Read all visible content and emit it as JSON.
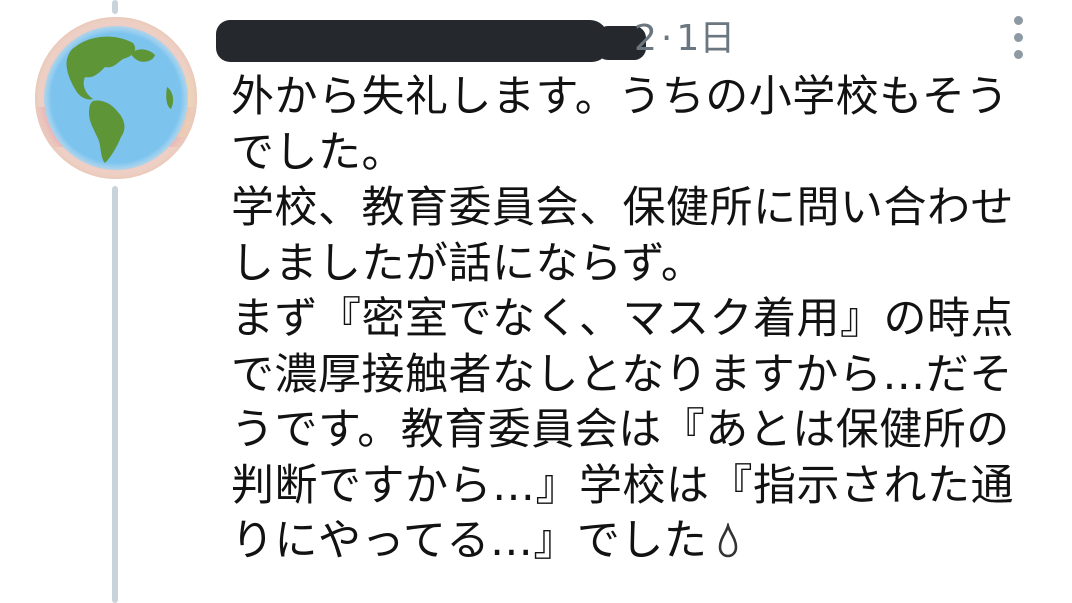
{
  "reply": {
    "time_prefix": "2",
    "time_separator": "·",
    "time_ago": "1日",
    "lines": [
      "外から失礼します。うちの小学校もそう",
      "でした。",
      "学校、教育委員会、保健所に問い合わせ",
      "しましたが話にならず。",
      "まず『密室でなく、マスク着用』の時点",
      "で濃厚接触者なしとなりますから…だそ",
      "うです。教育委員会は『あとは保健所の",
      "判断ですから…』学校は『指示された通",
      "りにやってる…』でした"
    ],
    "trailing_icon": "droplet-icon"
  },
  "colors": {
    "thread_line": "#c9d3da",
    "text": "#121212",
    "meta": "#6a7680",
    "redaction": "#25292d"
  }
}
